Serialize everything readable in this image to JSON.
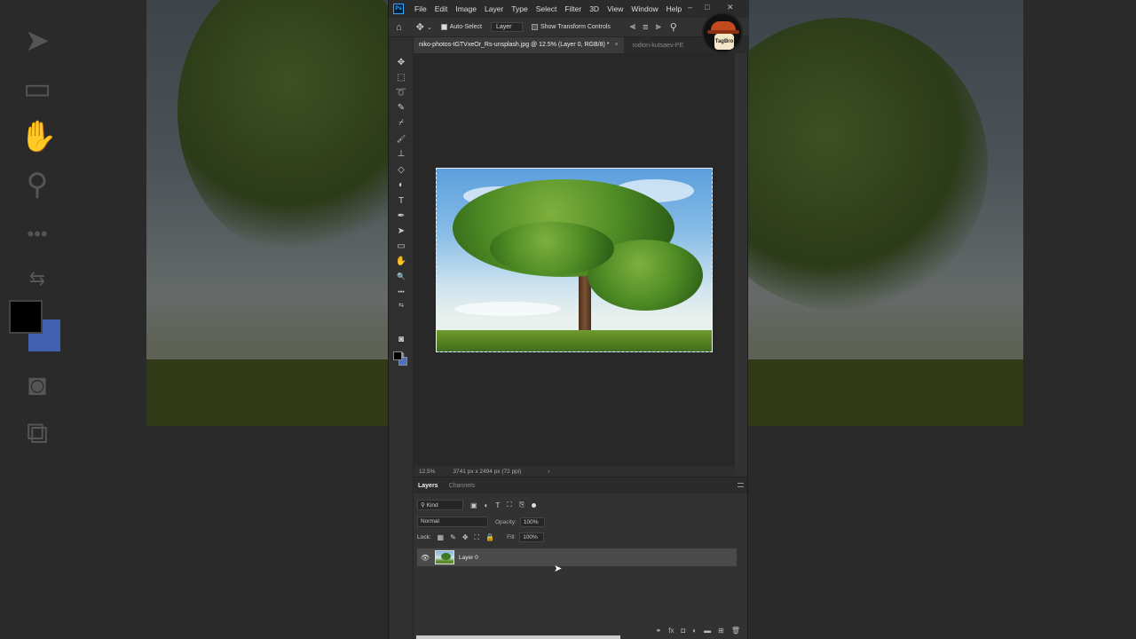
{
  "menubar": {
    "app_logo": "Ps",
    "items": [
      "File",
      "Edit",
      "Image",
      "Layer",
      "Type",
      "Select",
      "Filter",
      "3D",
      "View",
      "Window",
      "Help"
    ],
    "window_controls": [
      "–",
      "□",
      "✕"
    ]
  },
  "options_bar": {
    "auto_select_label": "Auto-Select",
    "auto_select_checked": true,
    "auto_select_target": "Layer",
    "show_transform_label": "Show Transform Controls",
    "show_transform_checked": false
  },
  "channel_badge": {
    "text": "TagBro"
  },
  "tabs": [
    {
      "label": "niko-photos-tGTVxeOr_Rs-unsplash.jpg @ 12.5% (Layer 0, RGB/8) *",
      "active": true
    },
    {
      "label": "rodion-kutsaev-PE",
      "active": false
    }
  ],
  "tools": [
    {
      "icon": "move-icon",
      "glyph": "✥"
    },
    {
      "icon": "marquee-icon",
      "glyph": "⬚"
    },
    {
      "icon": "lasso-icon",
      "glyph": "➰"
    },
    {
      "icon": "quick-select-icon",
      "glyph": "✎"
    },
    {
      "icon": "eyedropper-icon",
      "glyph": "⌿"
    },
    {
      "icon": "brush-icon",
      "glyph": "🖌"
    },
    {
      "icon": "stamp-icon",
      "glyph": "⊥"
    },
    {
      "icon": "eraser-icon",
      "glyph": "◇"
    },
    {
      "icon": "gradient-icon",
      "glyph": "◐"
    },
    {
      "icon": "type-icon",
      "glyph": "T"
    },
    {
      "icon": "pen-icon",
      "glyph": "✒"
    },
    {
      "icon": "path-select-icon",
      "glyph": "➤"
    },
    {
      "icon": "rectangle-icon",
      "glyph": "▭"
    },
    {
      "icon": "hand-icon",
      "glyph": "✋"
    },
    {
      "icon": "zoom-icon",
      "glyph": "🔍"
    },
    {
      "icon": "more-tools-icon",
      "glyph": "•••"
    }
  ],
  "colors": {
    "foreground": "#000000",
    "background": "#4a72c4"
  },
  "status": {
    "zoom": "12.5%",
    "dimensions": "3741 px x 2494 px (72 ppi)",
    "arrow": "›"
  },
  "layers_panel": {
    "tabs": [
      "Layers",
      "Channels"
    ],
    "filter_kind": "Kind",
    "blend_mode": "Normal",
    "opacity_label": "Opacity:",
    "opacity_value": "100%",
    "lock_label": "Lock:",
    "fill_label": "Fill:",
    "fill_value": "100%",
    "layers": [
      {
        "name": "Layer 0",
        "visible": true,
        "selected": true
      }
    ]
  }
}
